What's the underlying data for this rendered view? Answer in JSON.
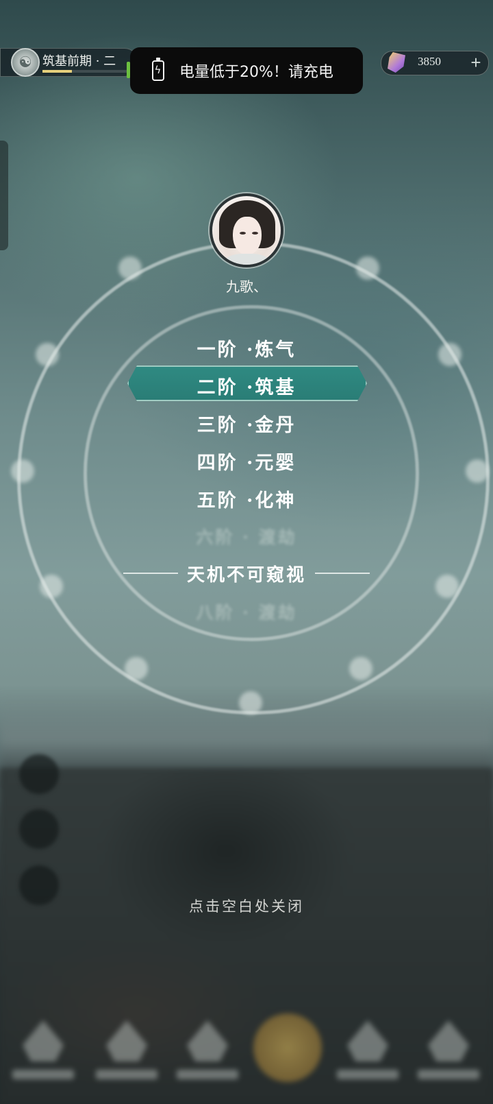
{
  "header": {
    "realm_title": "筑基前期 · 二",
    "realm_progress": 0.35,
    "currency_value": "3850",
    "plus_label": "+"
  },
  "toast": {
    "message": "电量低于20%！请充电"
  },
  "player": {
    "name": "九歌、"
  },
  "stages": [
    {
      "label": "一阶 ·炼气",
      "state": "unlocked"
    },
    {
      "label": "二阶 ·筑基",
      "state": "current"
    },
    {
      "label": "三阶 ·金丹",
      "state": "unlocked"
    },
    {
      "label": "四阶 ·元婴",
      "state": "unlocked"
    },
    {
      "label": "五阶 ·化神",
      "state": "unlocked"
    },
    {
      "label": "六阶 · 渡劫",
      "state": "hidden"
    },
    {
      "label": "八阶 · 渡劫",
      "state": "hidden"
    }
  ],
  "sealed_label": "天机不可窥视",
  "close_hint": "点击空白处关闭",
  "colors": {
    "highlight": "#2a7d76",
    "toast_bg": "#0b0b0b",
    "battery_green": "#6cc040"
  }
}
